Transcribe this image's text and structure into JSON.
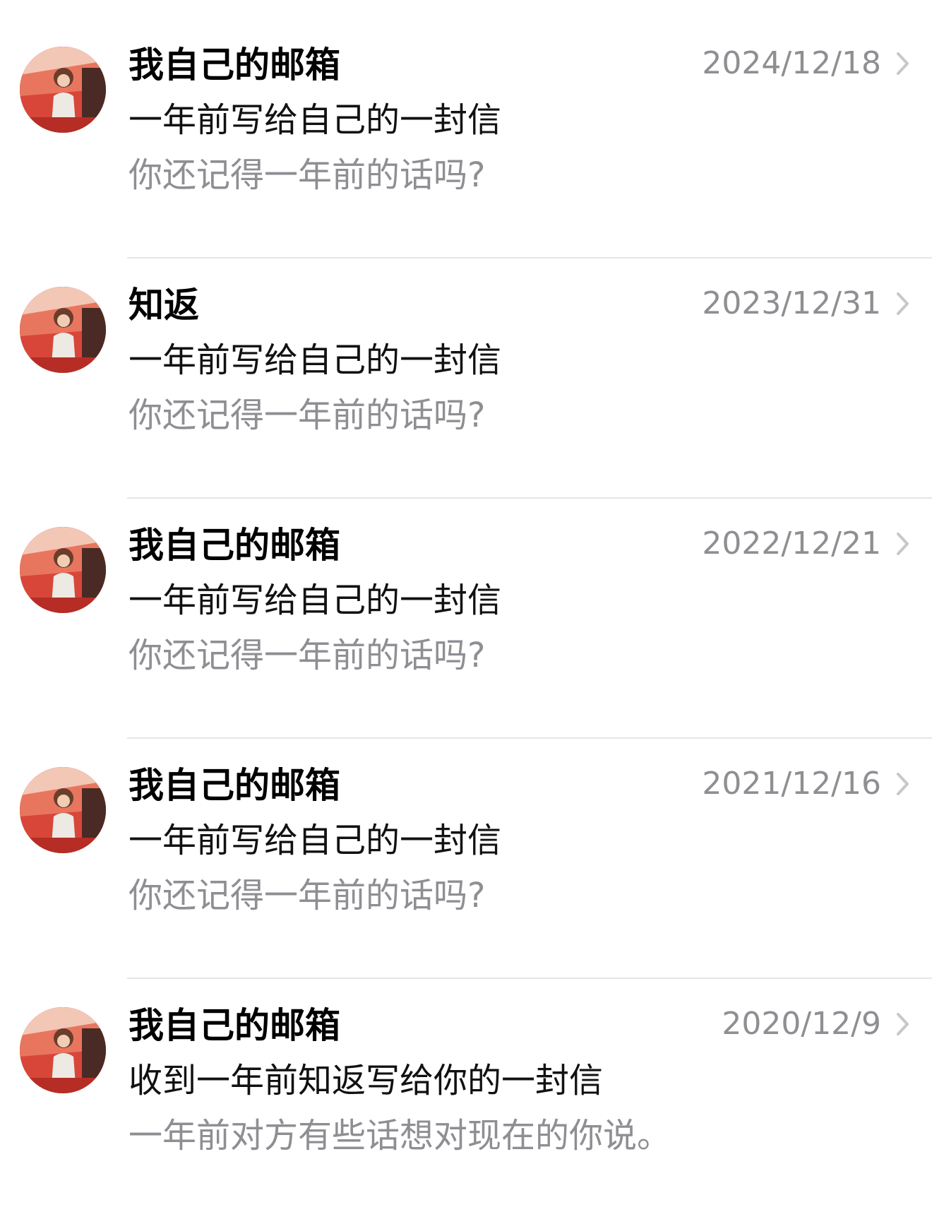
{
  "colors": {
    "title": "#000000",
    "subject": "#111111",
    "secondary": "#8e8e93",
    "divider": "#e5e5ea",
    "avatar_bg": "#c9392c"
  },
  "mail_list": {
    "items": [
      {
        "sender": "我自己的邮箱",
        "date": "2024/12/18",
        "subject": "一年前写给自己的一封信",
        "preview": "你还记得一年前的话吗?",
        "avatar_icon": "user-avatar-photo",
        "chevron_icon": "chevron-right-icon"
      },
      {
        "sender": "知返",
        "date": "2023/12/31",
        "subject": "一年前写给自己的一封信",
        "preview": "你还记得一年前的话吗?",
        "avatar_icon": "user-avatar-photo",
        "chevron_icon": "chevron-right-icon"
      },
      {
        "sender": "我自己的邮箱",
        "date": "2022/12/21",
        "subject": "一年前写给自己的一封信",
        "preview": "你还记得一年前的话吗?",
        "avatar_icon": "user-avatar-photo",
        "chevron_icon": "chevron-right-icon"
      },
      {
        "sender": "我自己的邮箱",
        "date": "2021/12/16",
        "subject": "一年前写给自己的一封信",
        "preview": "你还记得一年前的话吗?",
        "avatar_icon": "user-avatar-photo",
        "chevron_icon": "chevron-right-icon"
      },
      {
        "sender": "我自己的邮箱",
        "date": "2020/12/9",
        "subject": "收到一年前知返写给你的一封信",
        "preview": "一年前对方有些话想对现在的你说。",
        "avatar_icon": "user-avatar-photo",
        "chevron_icon": "chevron-right-icon"
      }
    ]
  }
}
